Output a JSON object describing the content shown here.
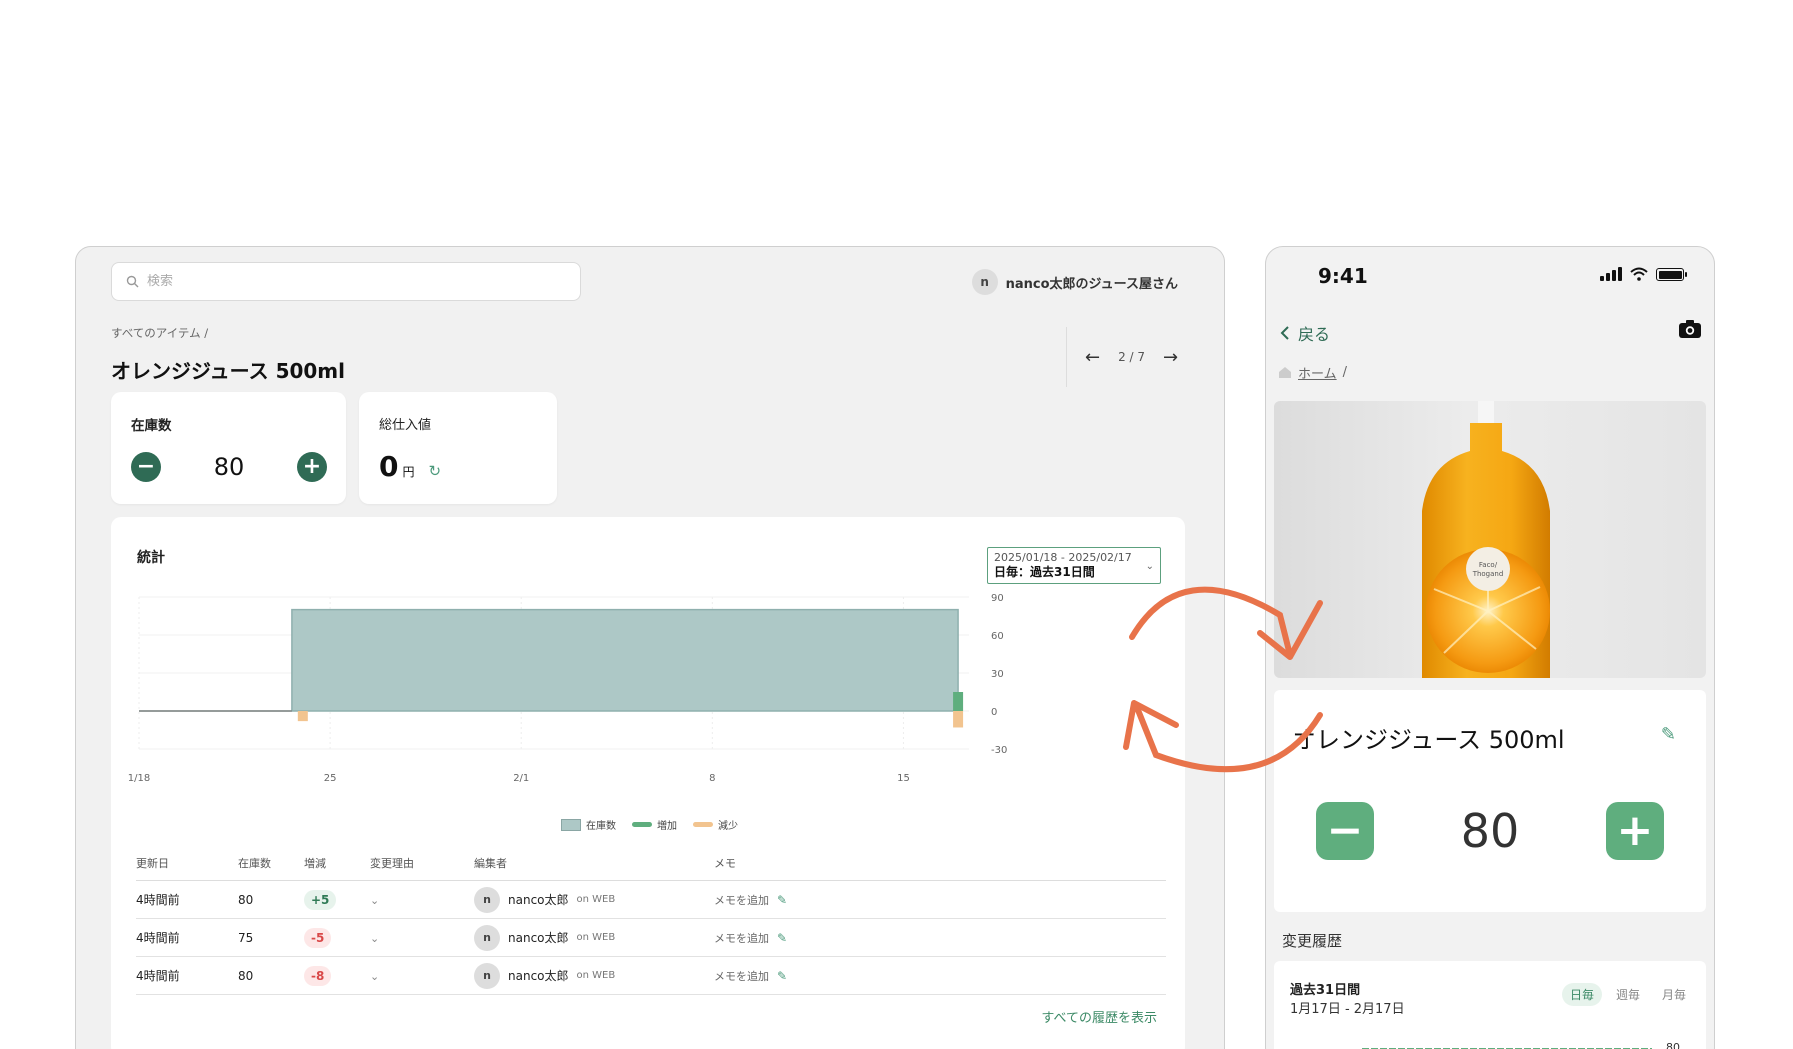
{
  "desktop": {
    "search": {
      "placeholder": "検索",
      "value": ""
    },
    "user": {
      "avatar_letter": "n",
      "name": "nanco太郎のジュース屋さん"
    },
    "breadcrumb": "すべてのアイテム /",
    "title": "オレンジジュース 500ml",
    "pager": {
      "label": "2 / 7"
    },
    "stock_card": {
      "label": "在庫数",
      "value": "80"
    },
    "cost_card": {
      "label": "総仕入値",
      "value": "0",
      "unit": "円"
    },
    "stats": {
      "title": "統計",
      "range_dates": "2025/01/18 - 2025/02/17",
      "range_label": "日毎：過去31日間",
      "legend": {
        "stock": "在庫数",
        "increase": "増加",
        "decrease": "減少"
      }
    },
    "history": {
      "headers": [
        "更新日",
        "在庫数",
        "増減",
        "変更理由",
        "編集者",
        "メモ"
      ],
      "rows": [
        {
          "date": "4時間前",
          "stock": "80",
          "change": "+5",
          "direction": "up",
          "editor": "nanco太郎",
          "via": "on WEB",
          "memo": "メモを追加"
        },
        {
          "date": "4時間前",
          "stock": "75",
          "change": "-5",
          "direction": "down",
          "editor": "nanco太郎",
          "via": "on WEB",
          "memo": "メモを追加"
        },
        {
          "date": "4時間前",
          "stock": "80",
          "change": "-8",
          "direction": "down",
          "editor": "nanco太郎",
          "via": "on WEB",
          "memo": "メモを追加"
        }
      ],
      "show_all": "すべての履歴を表示"
    }
  },
  "chart_data": {
    "type": "area",
    "title": "統計",
    "xlabel": "",
    "ylabel": "",
    "x_tick_labels": [
      "1/18",
      "25",
      "2/1",
      "8",
      "15"
    ],
    "x_tick_positions": [
      0,
      7,
      14,
      21,
      28
    ],
    "ylim": [
      -30,
      90
    ],
    "y_ticks": [
      90,
      60,
      30,
      0,
      -30
    ],
    "grid": true,
    "legend_position": "bottom",
    "series": [
      {
        "name": "在庫数",
        "kind": "area",
        "points": [
          [
            0,
            0
          ],
          [
            5.6,
            0
          ],
          [
            5.6,
            80
          ],
          [
            30,
            80
          ]
        ]
      },
      {
        "name": "増加",
        "kind": "bar",
        "points": [
          [
            30,
            5
          ]
        ]
      },
      {
        "name": "減少",
        "kind": "bar",
        "points": [
          [
            6,
            -8
          ],
          [
            30,
            -13
          ]
        ]
      }
    ],
    "colors": {
      "stock": "#adc8c6",
      "increase": "#5fae7e",
      "decrease": "#f2c48f"
    }
  },
  "mobile": {
    "time": "9:41",
    "back_label": "戻る",
    "breadcrumb_home": "ホーム",
    "breadcrumb_sep": "/",
    "product_label_line1": "Faco/",
    "product_label_line2": "Thogand",
    "title": "オレンジジュース 500ml",
    "stock_value": "80",
    "history_label": "変更履歴",
    "period_label": "過去31日間",
    "period_range": "1月17日 - 2月17日",
    "tabs": [
      "日毎",
      "週毎",
      "月毎"
    ],
    "mini_chart_label": "80"
  },
  "colors": {
    "accent": "#2f6b55",
    "accent_light": "#5fae7e",
    "arrow": "#e8734a"
  }
}
